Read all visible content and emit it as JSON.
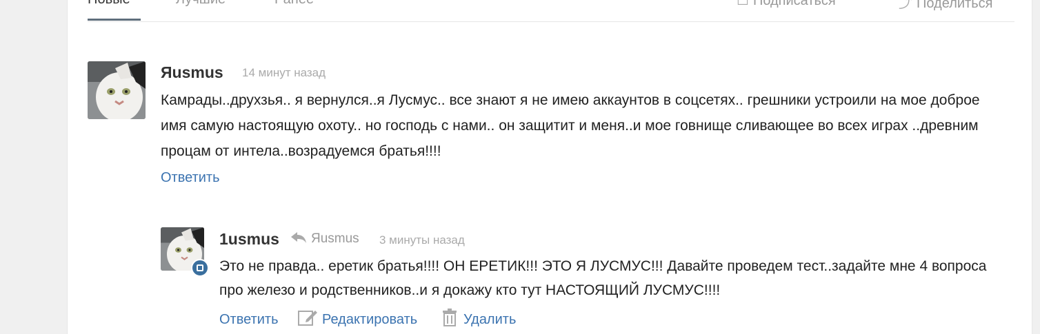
{
  "tabs": [
    {
      "label": "Новые"
    },
    {
      "label": "Лучшие"
    },
    {
      "label": "Ранее"
    }
  ],
  "top_actions": {
    "subscribe": "Подписаться",
    "share": "Поделиться"
  },
  "comments": [
    {
      "author": "Яusmus",
      "time": "14 минут назад",
      "text": "Камрады..друхзья.. я вернулся..я Лусмус.. все знают я не имею аккаунтов в соцсетях.. грешники устроили на мое доброе имя самую настоящую охоту.. но господь с нами.. он защитит и меня..и мое говнище сливающее во всех играх ..древним процам от интела..возрадуемся братья!!!!",
      "reply_label": "Ответить"
    },
    {
      "author": "1usmus",
      "reply_to": "Яusmus",
      "time": "3 минуты назад",
      "text": "Это не правда.. еретик братья!!!! ОН ЕРЕТИК!!! ЭТО Я ЛУСМУС!!! Давайте проведем тест..задайте мне 4 вопроса про  железо и родственников..и я докажу кто тут НАСТОЯЩИЙ ЛУСМУС!!!!",
      "reply_label": "Ответить",
      "edit_label": "Редактировать",
      "delete_label": "Удалить"
    }
  ],
  "colors": {
    "link": "#3b73b0",
    "badge": "#3a6f9e",
    "tab_underline": "#5f6e7c"
  },
  "icons": {
    "subscribe": "checkbox-icon",
    "share": "share-icon",
    "reply_to": "reply-arrow-icon",
    "edit": "pencil-icon",
    "delete": "trash-icon",
    "badge": "instagram-icon"
  }
}
